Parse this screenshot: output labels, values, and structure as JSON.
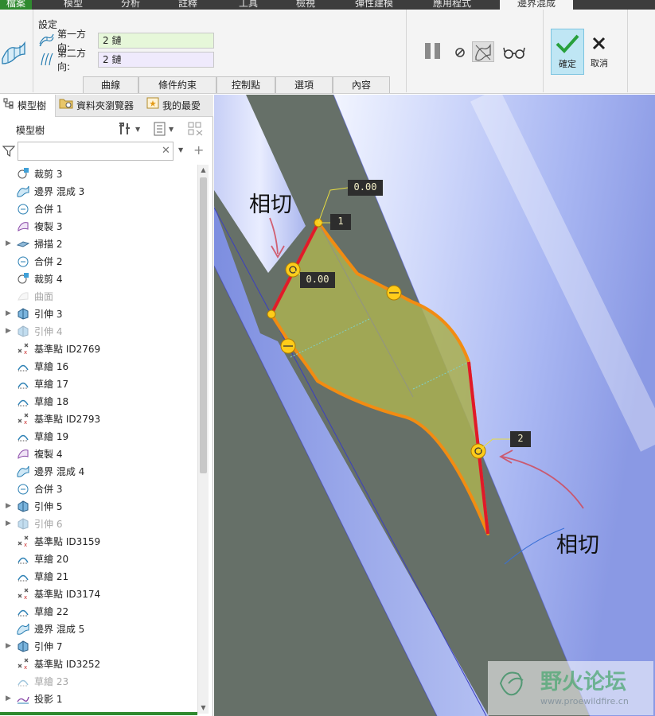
{
  "menu": {
    "tabs": [
      "檔案",
      "模型",
      "分析",
      "註釋",
      "工具",
      "檢視",
      "彈性建模",
      "應用程式",
      "邊界混成"
    ]
  },
  "ribbon": {
    "settings_label": "設定",
    "first_direction_label": "第一方向:",
    "first_direction_value": "2 鏈",
    "second_direction_label": "第二方向:",
    "second_direction_value": "2 鏈",
    "subtabs": [
      "曲線",
      "條件約束",
      "控制點",
      "選項",
      "內容"
    ],
    "ok_label": "確定",
    "cancel_label": "取消",
    "colors": {
      "first_field": "#e6f7d9",
      "second_field": "#efeafc",
      "ok_bg": "#bfe6f4",
      "accent": "#2f8a2f"
    }
  },
  "panel": {
    "tabs": [
      "模型樹",
      "資料夾瀏覽器",
      "我的最愛"
    ],
    "tree_title": "模型樹",
    "search_value": "",
    "items": [
      {
        "label": "裁剪 3",
        "icon": "trim-icon",
        "expandable": false,
        "disabled": false
      },
      {
        "label": "邊界 混成 3",
        "icon": "boundary-blend-icon",
        "expandable": false,
        "disabled": false
      },
      {
        "label": "合併 1",
        "icon": "merge-icon",
        "expandable": false,
        "disabled": false
      },
      {
        "label": "複製 3",
        "icon": "copy-icon",
        "expandable": false,
        "disabled": false
      },
      {
        "label": "掃描 2",
        "icon": "sweep-icon",
        "expandable": true,
        "disabled": false
      },
      {
        "label": "合併 2",
        "icon": "merge-icon",
        "expandable": false,
        "disabled": false
      },
      {
        "label": "裁剪 4",
        "icon": "trim-icon",
        "expandable": false,
        "disabled": false
      },
      {
        "label": "曲面",
        "icon": "surface-icon",
        "expandable": false,
        "disabled": true
      },
      {
        "label": "引伸 3",
        "icon": "extrude-icon",
        "expandable": true,
        "disabled": false
      },
      {
        "label": "引伸 4",
        "icon": "extrude-icon",
        "expandable": true,
        "disabled": true
      },
      {
        "label": "基準點 ID2769",
        "icon": "datum-point-icon",
        "expandable": false,
        "disabled": false
      },
      {
        "label": "草繪 16",
        "icon": "sketch-icon",
        "expandable": false,
        "disabled": false
      },
      {
        "label": "草繪 17",
        "icon": "sketch-icon",
        "expandable": false,
        "disabled": false
      },
      {
        "label": "草繪 18",
        "icon": "sketch-icon",
        "expandable": false,
        "disabled": false
      },
      {
        "label": "基準點 ID2793",
        "icon": "datum-point-icon",
        "expandable": false,
        "disabled": false
      },
      {
        "label": "草繪 19",
        "icon": "sketch-icon",
        "expandable": false,
        "disabled": false
      },
      {
        "label": "複製 4",
        "icon": "copy-icon",
        "expandable": false,
        "disabled": false
      },
      {
        "label": "邊界 混成 4",
        "icon": "boundary-blend-icon",
        "expandable": false,
        "disabled": false
      },
      {
        "label": "合併 3",
        "icon": "merge-icon",
        "expandable": false,
        "disabled": false
      },
      {
        "label": "引伸 5",
        "icon": "extrude-icon",
        "expandable": true,
        "disabled": false
      },
      {
        "label": "引伸 6",
        "icon": "extrude-icon",
        "expandable": true,
        "disabled": true
      },
      {
        "label": "基準點 ID3159",
        "icon": "datum-point-icon",
        "expandable": false,
        "disabled": false
      },
      {
        "label": "草繪 20",
        "icon": "sketch-icon",
        "expandable": false,
        "disabled": false
      },
      {
        "label": "草繪 21",
        "icon": "sketch-icon",
        "expandable": false,
        "disabled": false
      },
      {
        "label": "基準點 ID3174",
        "icon": "datum-point-icon",
        "expandable": false,
        "disabled": false
      },
      {
        "label": "草繪 22",
        "icon": "sketch-icon",
        "expandable": false,
        "disabled": false
      },
      {
        "label": "邊界 混成 5",
        "icon": "boundary-blend-icon",
        "expandable": false,
        "disabled": false
      },
      {
        "label": "引伸 7",
        "icon": "extrude-icon",
        "expandable": true,
        "disabled": false
      },
      {
        "label": "基準點 ID3252",
        "icon": "datum-point-icon",
        "expandable": false,
        "disabled": false
      },
      {
        "label": "草繪 23",
        "icon": "sketch-icon",
        "expandable": false,
        "disabled": true
      },
      {
        "label": "投影 1",
        "icon": "projection-icon",
        "expandable": true,
        "disabled": false
      }
    ]
  },
  "viewport": {
    "annotation_tangent_1": "相切",
    "annotation_tangent_2": "相切",
    "dim_top": "0.00",
    "dim_left": "0.00",
    "tag_1": "1",
    "tag_2": "2",
    "watermark_title": "野火论坛",
    "watermark_url": "www.proewildfire.cn"
  }
}
